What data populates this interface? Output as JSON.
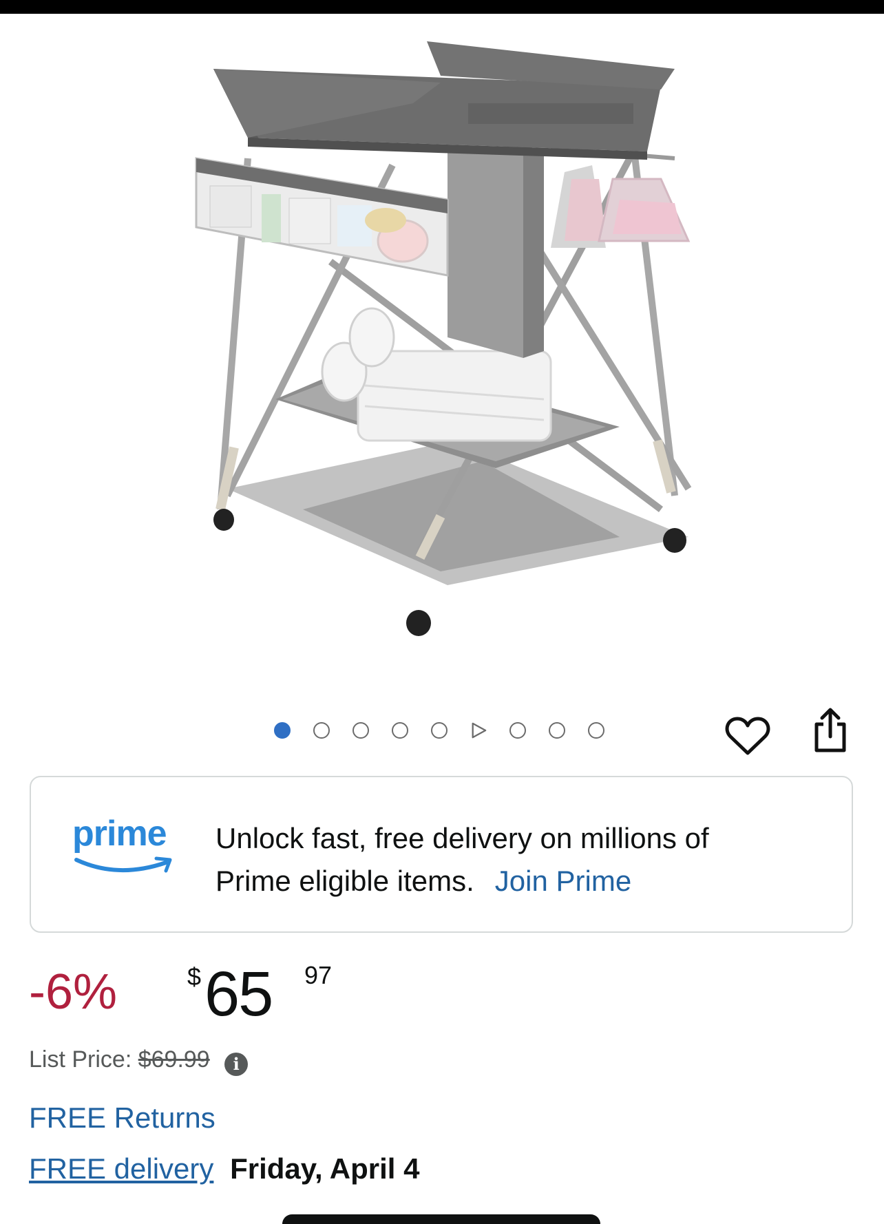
{
  "product": {
    "image_alt": "Folding baby changing table"
  },
  "carousel": {
    "total_dots": 9,
    "active_index": 0,
    "video_index": 5
  },
  "icons": {
    "wishlist": "heart-icon",
    "share": "share-icon",
    "info": "info-icon"
  },
  "prime": {
    "logo_text": "prime",
    "message_line1": "Unlock fast, free delivery on millions of",
    "message_line2": "Prime eligible items.",
    "join_link": "Join Prime",
    "brand_color": "#2b88d9"
  },
  "price": {
    "discount": "-6%",
    "currency_symbol": "$",
    "whole": "65",
    "fraction": "97",
    "discount_color": "#b0203e"
  },
  "list_price": {
    "label": "List Price:",
    "value": "$69.99",
    "info_glyph": "i"
  },
  "returns": {
    "label": "FREE Returns"
  },
  "delivery": {
    "link_label": "FREE delivery",
    "date": "Friday, April 4"
  },
  "colors": {
    "link": "#2162a1",
    "text": "#0f1111",
    "muted": "#565959"
  }
}
